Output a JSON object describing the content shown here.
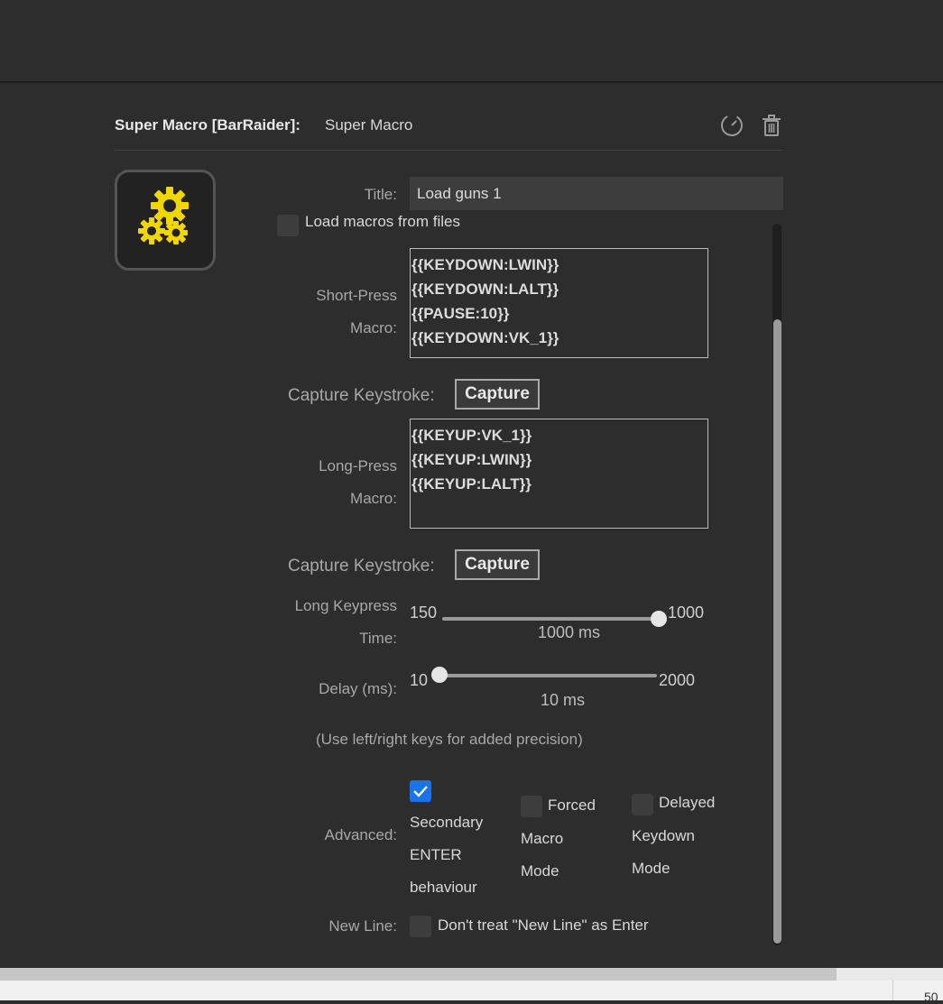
{
  "header": {
    "plugin_name": "Super Macro [BarRaider]:",
    "action_name": "Super Macro",
    "icons": [
      "gauge-icon",
      "trash-icon"
    ]
  },
  "key_icon": "gears-icon",
  "title": {
    "label": "Title:",
    "value": "Load guns 1"
  },
  "load_macros": {
    "label": "Load macros from files",
    "checked": false
  },
  "short_press": {
    "label_line1": "Short-Press",
    "label_line2": "Macro:",
    "lines": [
      "{{KEYDOWN:LWIN}}",
      "{{KEYDOWN:LALT}}",
      "{{PAUSE:10}}",
      "{{KEYDOWN:VK_1}}"
    ]
  },
  "capture1": {
    "label": "Capture Keystroke:",
    "button": "Capture"
  },
  "long_press": {
    "label_line1": "Long-Press",
    "label_line2": "Macro:",
    "lines": [
      "{{KEYUP:VK_1}}",
      "{{KEYUP:LWIN}}",
      "{{KEYUP:LALT}}"
    ]
  },
  "capture2": {
    "label": "Capture Keystroke:",
    "button": "Capture"
  },
  "long_keypress": {
    "label_line1": "Long Keypress",
    "label_line2": "Time:",
    "min": "150",
    "max": "1000",
    "value_text": "1000 ms",
    "value": 1000
  },
  "delay": {
    "label": "Delay (ms):",
    "min": "10",
    "max": "2000",
    "value_text": "10 ms",
    "value": 10
  },
  "hint": "(Use left/right keys for added precision)",
  "advanced": {
    "label": "Advanced:",
    "options": [
      {
        "lines": [
          "Secondary",
          "ENTER",
          "behaviour"
        ],
        "checked": true
      },
      {
        "lines": [
          "Forced",
          "Macro",
          "Mode"
        ],
        "checked": false
      },
      {
        "lines": [
          "Delayed",
          "Keydown",
          "Mode"
        ],
        "checked": false
      }
    ]
  },
  "new_line": {
    "label": "New Line:",
    "option": "Don't treat \"New Line\" as Enter",
    "checked": false
  },
  "status": {
    "zoom": "50"
  },
  "colors": {
    "accent": "#1a73e8",
    "gear": "#f2d600",
    "background": "#2d2d2d"
  }
}
